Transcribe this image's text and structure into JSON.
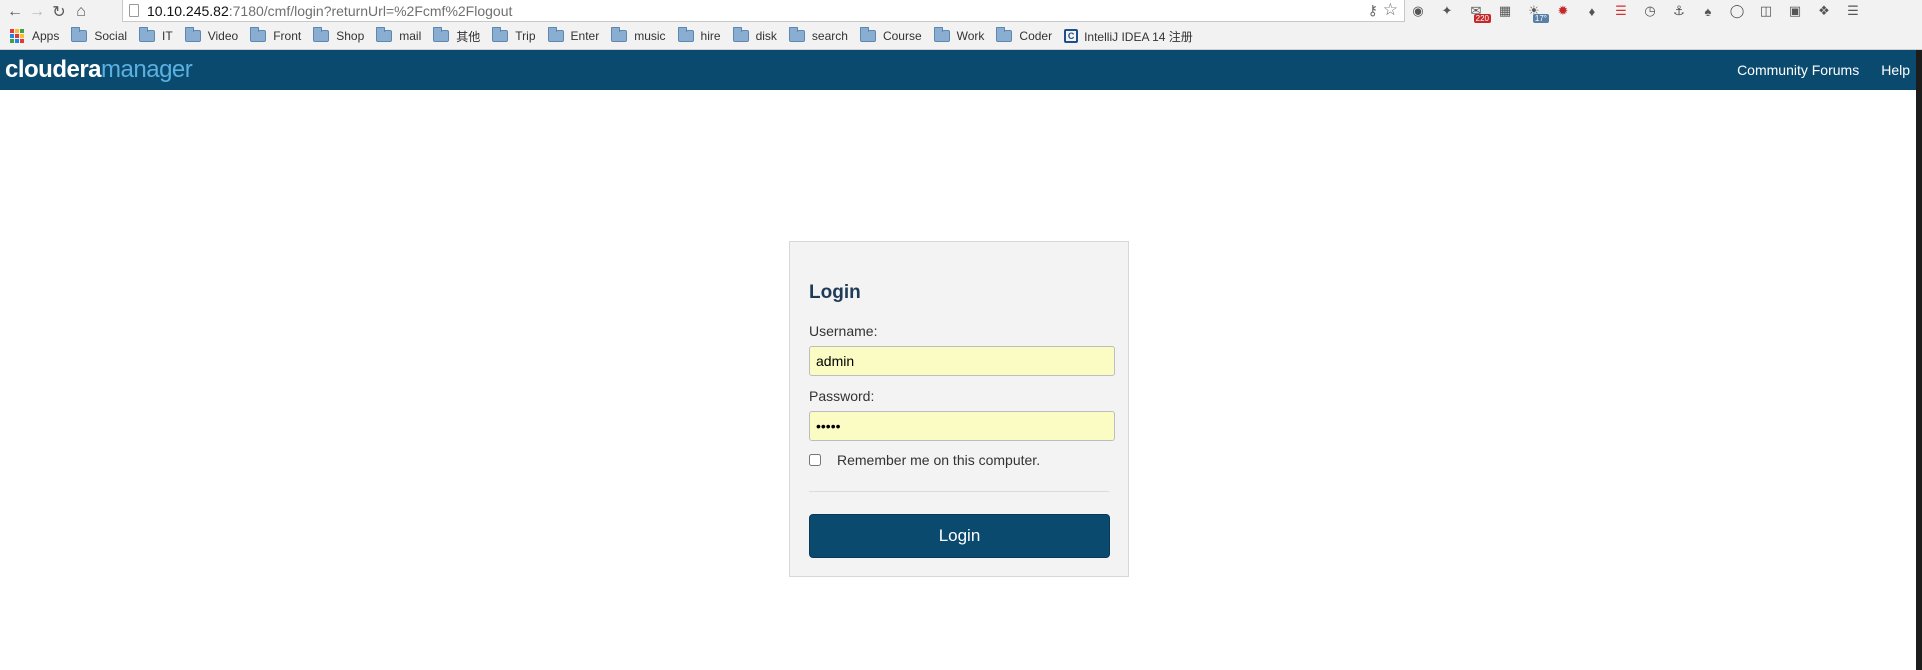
{
  "browser": {
    "url_host": "10.10.245.82",
    "url_path": ":7180/cmf/login?returnUrl=%2Fcmf%2Flogout",
    "badges": {
      "mail_count": "220",
      "weather_temp": "17°"
    }
  },
  "bookmarks": {
    "apps_label": "Apps",
    "folders": [
      "Social",
      "IT",
      "Video",
      "Front",
      "Shop",
      "mail",
      "其他",
      "Trip",
      "Enter",
      "music",
      "hire",
      "disk",
      "search",
      "Course",
      "Work",
      "Coder"
    ],
    "last_label": "IntelliJ IDEA 14 注册"
  },
  "header": {
    "logo_part1": "cloudera",
    "logo_part2": "manager",
    "links": [
      "Community Forums",
      "Help"
    ],
    "bg_color": "#0b4a6f"
  },
  "login": {
    "title": "Login",
    "username_label": "Username:",
    "username_value": "admin",
    "password_label": "Password:",
    "password_value": "admin",
    "remember_label": "Remember me on this computer.",
    "remember_checked": false,
    "submit_label": "Login"
  }
}
